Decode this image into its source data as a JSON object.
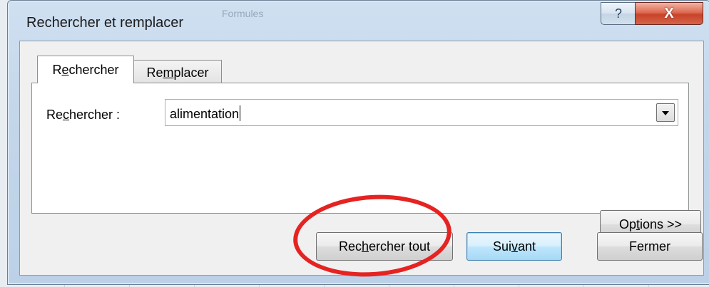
{
  "window": {
    "title": "Rechercher et remplacer",
    "background_text": "Formules",
    "help_glyph": "?",
    "close_glyph": "X"
  },
  "tabs": [
    {
      "label_pre": "R",
      "label_u": "e",
      "label_post": "chercher",
      "active": true
    },
    {
      "label_pre": "Re",
      "label_u": "m",
      "label_post": "placer",
      "active": false
    }
  ],
  "search": {
    "label_pre": "Re",
    "label_u": "c",
    "label_post": "hercher :",
    "value": "alimentation"
  },
  "buttons": {
    "options": {
      "pre": "Op",
      "u": "t",
      "post": "ions >>"
    },
    "find_all": {
      "pre": "Rec",
      "u": "h",
      "post": "ercher tout"
    },
    "next": {
      "pre": "Sui",
      "u": "v",
      "post": "ant"
    },
    "close": {
      "label": "Fermer"
    }
  },
  "colors": {
    "annotation_ring": "#e52321",
    "close_button": "#c84329"
  }
}
